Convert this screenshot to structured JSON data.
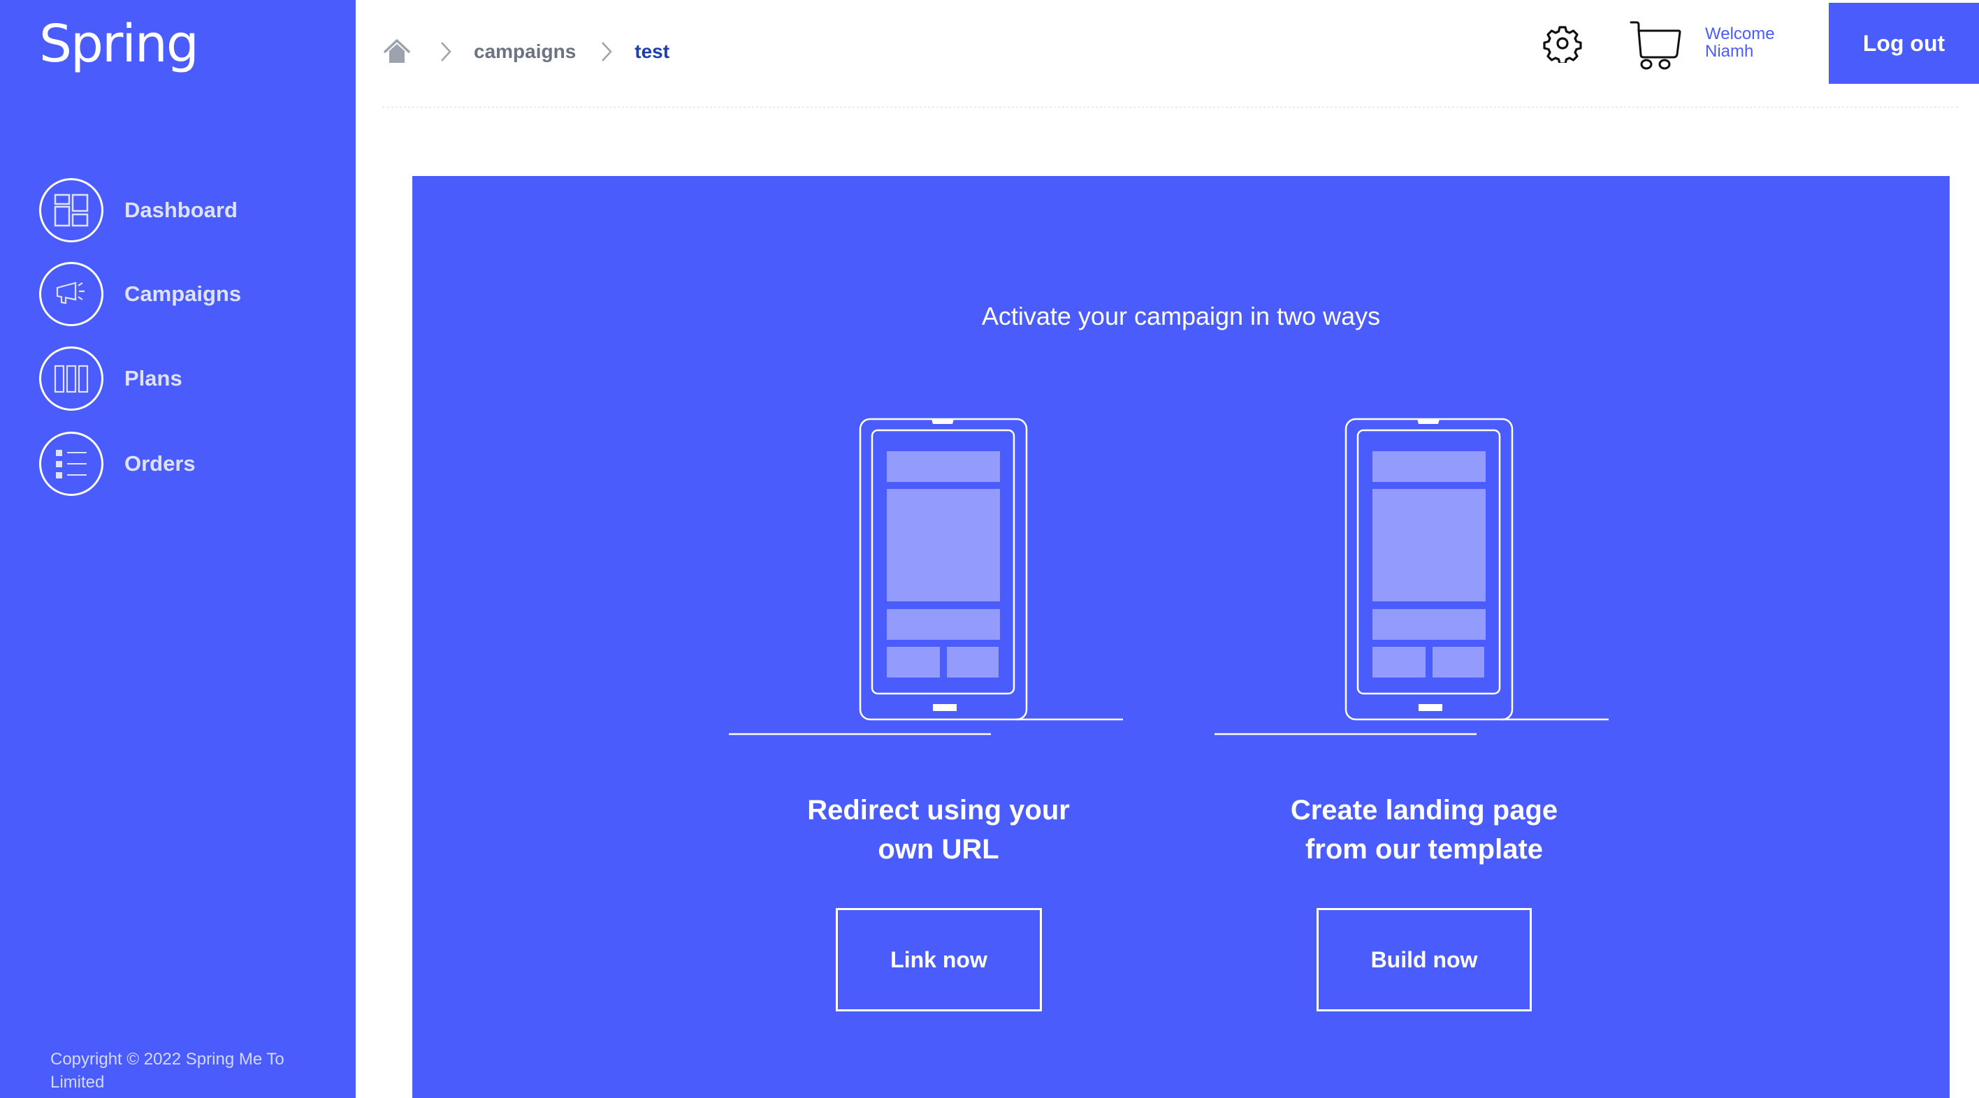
{
  "app": {
    "logo_text": "Spring"
  },
  "sidebar": {
    "items": [
      {
        "label": "Dashboard",
        "icon": "dashboard-icon"
      },
      {
        "label": "Campaigns",
        "icon": "megaphone-icon"
      },
      {
        "label": "Plans",
        "icon": "columns-icon"
      },
      {
        "label": "Orders",
        "icon": "list-icon"
      }
    ],
    "copyright": "Copyright © 2022 Spring Me To Limited"
  },
  "breadcrumb": {
    "home_icon": "home-icon",
    "items": [
      {
        "label": "campaigns"
      },
      {
        "label": "test"
      }
    ]
  },
  "header": {
    "settings_icon": "gear-icon",
    "cart_icon": "cart-icon",
    "welcome_line1": "Welcome",
    "welcome_line2": "Niamh",
    "logout_label": "Log out"
  },
  "main": {
    "headline": "Activate your campaign in two ways",
    "options": [
      {
        "title_line1": "Redirect using your",
        "title_line2": "own URL",
        "button_label": "Link now"
      },
      {
        "title_line1": "Create landing page",
        "title_line2": "from our template",
        "button_label": "Build now"
      }
    ]
  },
  "colors": {
    "brand": "#4a5cfc",
    "breadcrumb_current": "#1e3fae",
    "breadcrumb_link": "#6b7280",
    "phone_block": "#939bfd"
  }
}
